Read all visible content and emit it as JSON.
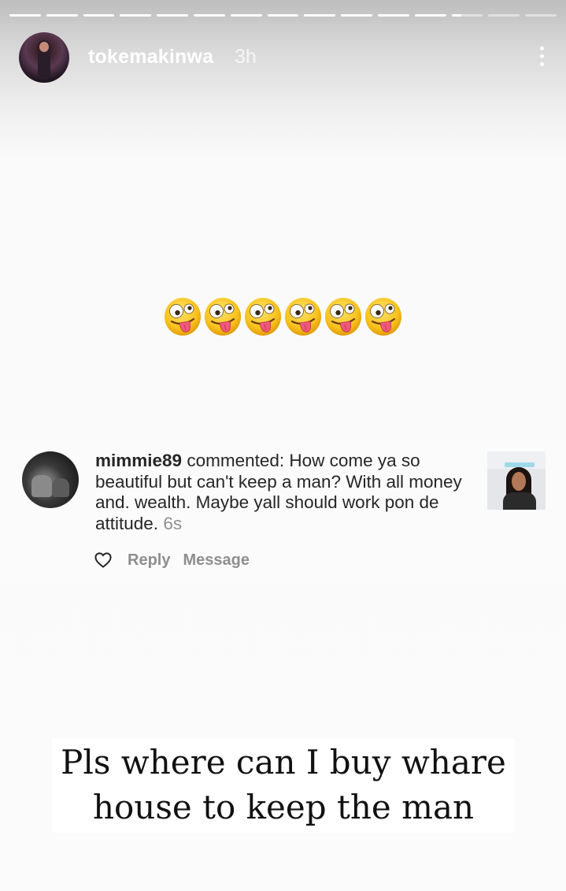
{
  "story": {
    "username": "tokemakinwa",
    "time_ago": "3h",
    "progress": {
      "segment_count": 15,
      "completed_segments": 12,
      "current_segment_fraction": 0.3
    },
    "emoji": {
      "name": "zany-face",
      "count": 6
    }
  },
  "comment": {
    "username": "mimmie89",
    "body": " commented: How come ya so beautiful but can't keep a man?  With all money and. wealth. Maybe yall should work pon de attitude. ",
    "time_ago": "6s",
    "actions": {
      "reply_label": "Reply",
      "message_label": "Message"
    }
  },
  "caption": {
    "line1": "Pls where can I buy whare",
    "line2": "house to keep the man"
  },
  "icons": {
    "more": "more-vertical-icon",
    "like": "heart-icon"
  },
  "colors": {
    "comment_text": "#262626",
    "muted": "#8e8e8e",
    "caption_text": "#111111"
  }
}
